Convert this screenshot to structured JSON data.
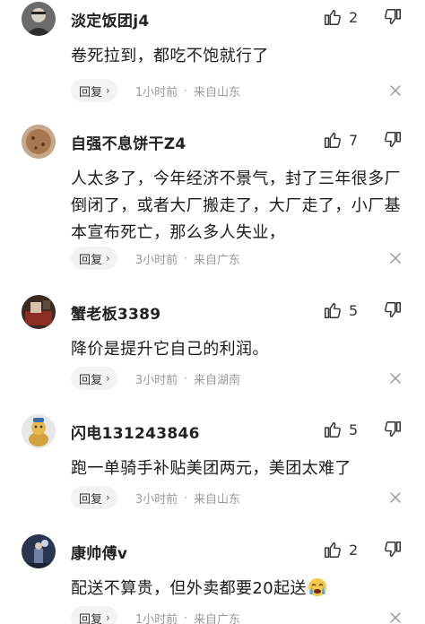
{
  "comments": [
    {
      "username": "淡定饭团j4",
      "text": "卷死拉到，都吃不饱就行了",
      "likes": "2",
      "reply_label": "回复",
      "time": "1小时前",
      "location": "来自山东",
      "avatar": "avatar-dark-portrait"
    },
    {
      "username": "自强不息饼干Z4",
      "text": "人太多了，今年经济不景气，封了三年很多厂倒闭了，或者大厂搬走了，大厂走了，小厂基本宣布死亡，那么多人失业，",
      "likes": "7",
      "reply_label": "回复",
      "time": "3小时前",
      "location": "来自广东",
      "avatar": "avatar-cookie"
    },
    {
      "username": "蟹老板3389",
      "text": "降价是提升它自己的利润。",
      "likes": "5",
      "reply_label": "回复",
      "time": "3小时前",
      "location": "来自湖南",
      "avatar": "avatar-room"
    },
    {
      "username": "闪电131243846",
      "text": "跑一单骑手补贴美团两元，美团太难了",
      "likes": "5",
      "reply_label": "回复",
      "time": "3小时前",
      "location": "来自山东",
      "avatar": "avatar-cartoon"
    },
    {
      "username": "康帅傅v",
      "text": "配送不算贵，但外卖都要20起送",
      "emoji": "crying-face-emoji",
      "likes": "2",
      "reply_label": "回复",
      "time": "1小时前",
      "location": "来自广东",
      "avatar": "avatar-night"
    }
  ],
  "icons": {
    "like": "thumbs-up-icon",
    "dislike": "thumbs-down-icon",
    "close": "close-icon",
    "reply_chevron": "›"
  },
  "colors": {
    "reply_bg": "#f3f3f3",
    "meta_text": "#999999",
    "main_text": "#1a1a1a"
  },
  "separator": "·"
}
